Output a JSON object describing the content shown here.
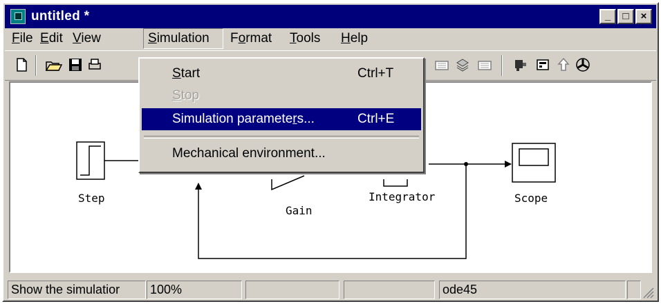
{
  "window": {
    "title": "untitled *",
    "controls": [
      "_",
      "□",
      "×"
    ]
  },
  "menubar": {
    "items": [
      {
        "label": "File"
      },
      {
        "label": "Edit"
      },
      {
        "label": "View"
      },
      {
        "label": "Simulation"
      },
      {
        "label": "Format"
      },
      {
        "label": "Tools"
      },
      {
        "label": "Help"
      }
    ]
  },
  "simulation_menu": {
    "items": [
      {
        "label": "Start",
        "shortcut": "Ctrl+T",
        "enabled": true
      },
      {
        "label": "Stop",
        "shortcut": "",
        "enabled": false
      },
      {
        "label": "Simulation parameters...",
        "shortcut": "Ctrl+E",
        "enabled": true,
        "highlighted": true
      },
      {
        "label": "Mechanical environment...",
        "shortcut": "",
        "enabled": true
      }
    ]
  },
  "toolbar": {
    "icons": [
      "new-icon",
      "open-icon",
      "save-icon",
      "print-icon",
      "library-icon",
      "model-icon",
      "debug-icon",
      "build-icon",
      "settings-icon",
      "up-icon",
      "options-icon"
    ]
  },
  "diagram": {
    "blocks": [
      {
        "name": "Step"
      },
      {
        "name": "Gain"
      },
      {
        "name": "Integrator"
      },
      {
        "name": "Scope"
      }
    ]
  },
  "statusbar": {
    "message": "Show the simulatior",
    "zoom": "100%",
    "pane3": "",
    "pane4": "",
    "solver": "ode45",
    "pane6": ""
  }
}
